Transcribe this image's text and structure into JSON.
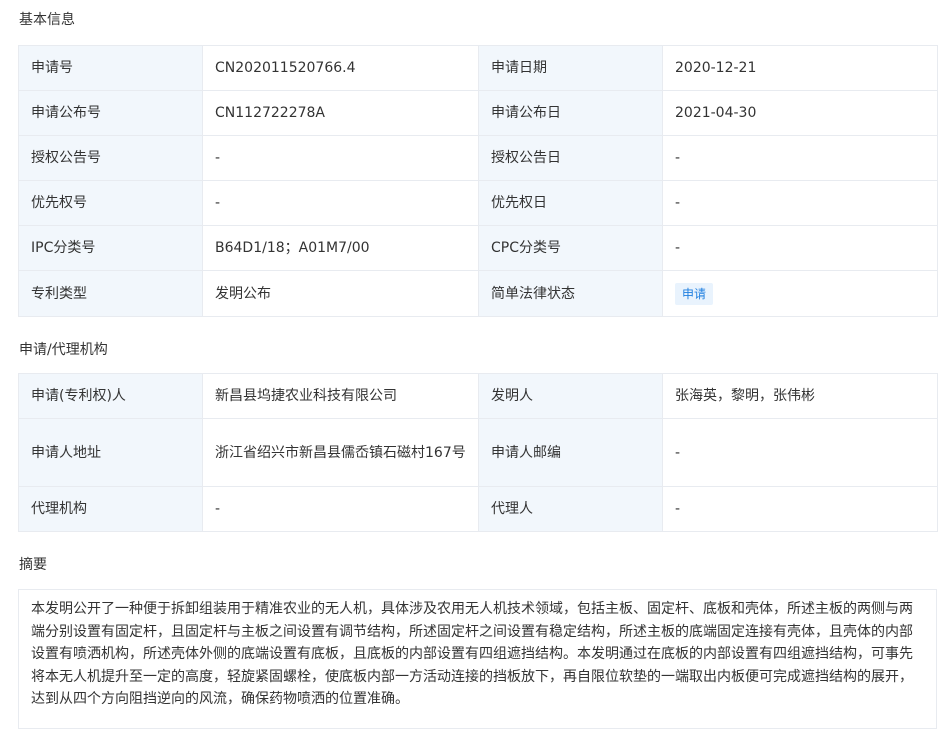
{
  "sections": {
    "basic": "基本信息",
    "agency": "申请/代理机构",
    "abstract": "摘要"
  },
  "basic": {
    "app_no_label": "申请号",
    "app_no": "CN202011520766.4",
    "app_date_label": "申请日期",
    "app_date": "2020-12-21",
    "pub_no_label": "申请公布号",
    "pub_no": "CN112722278A",
    "pub_date_label": "申请公布日",
    "pub_date": "2021-04-30",
    "grant_no_label": "授权公告号",
    "grant_no": "-",
    "grant_date_label": "授权公告日",
    "grant_date": "-",
    "priority_no_label": "优先权号",
    "priority_no": "-",
    "priority_date_label": "优先权日",
    "priority_date": "-",
    "ipc_label": "IPC分类号",
    "ipc": "B64D1/18；A01M7/00",
    "cpc_label": "CPC分类号",
    "cpc": "-",
    "type_label": "专利类型",
    "type": "发明公布",
    "legal_status_label": "简单法律状态",
    "legal_status": "申请"
  },
  "agency": {
    "applicant_label": "申请(专利权)人",
    "applicant": "新昌县坞捷农业科技有限公司",
    "inventor_label": "发明人",
    "inventor": "张海英，黎明，张伟彬",
    "address_label": "申请人地址",
    "address": "浙江省绍兴市新昌县儒岙镇石磁村167号",
    "zip_label": "申请人邮编",
    "zip": "-",
    "agency_label": "代理机构",
    "agency": "-",
    "agent_label": "代理人",
    "agent": "-"
  },
  "abstract": {
    "text": "本发明公开了一种便于拆卸组装用于精准农业的无人机，具体涉及农用无人机技术领域，包括主板、固定杆、底板和壳体，所述主板的两侧与两端分别设置有固定杆，且固定杆与主板之间设置有调节结构，所述固定杆之间设置有稳定结构，所述主板的底端固定连接有壳体，且壳体的内部设置有喷洒机构，所述壳体外侧的底端设置有底板，且底板的内部设置有四组遮挡结构。本发明通过在底板的内部设置有四组遮挡结构，可事先将本无人机提升至一定的高度，轻旋紧固螺栓，使底板内部一方活动连接的挡板放下，再自限位软垫的一端取出内板便可完成遮挡结构的展开，达到从四个方向阻挡逆向的风流，确保药物喷洒的位置准确。"
  }
}
